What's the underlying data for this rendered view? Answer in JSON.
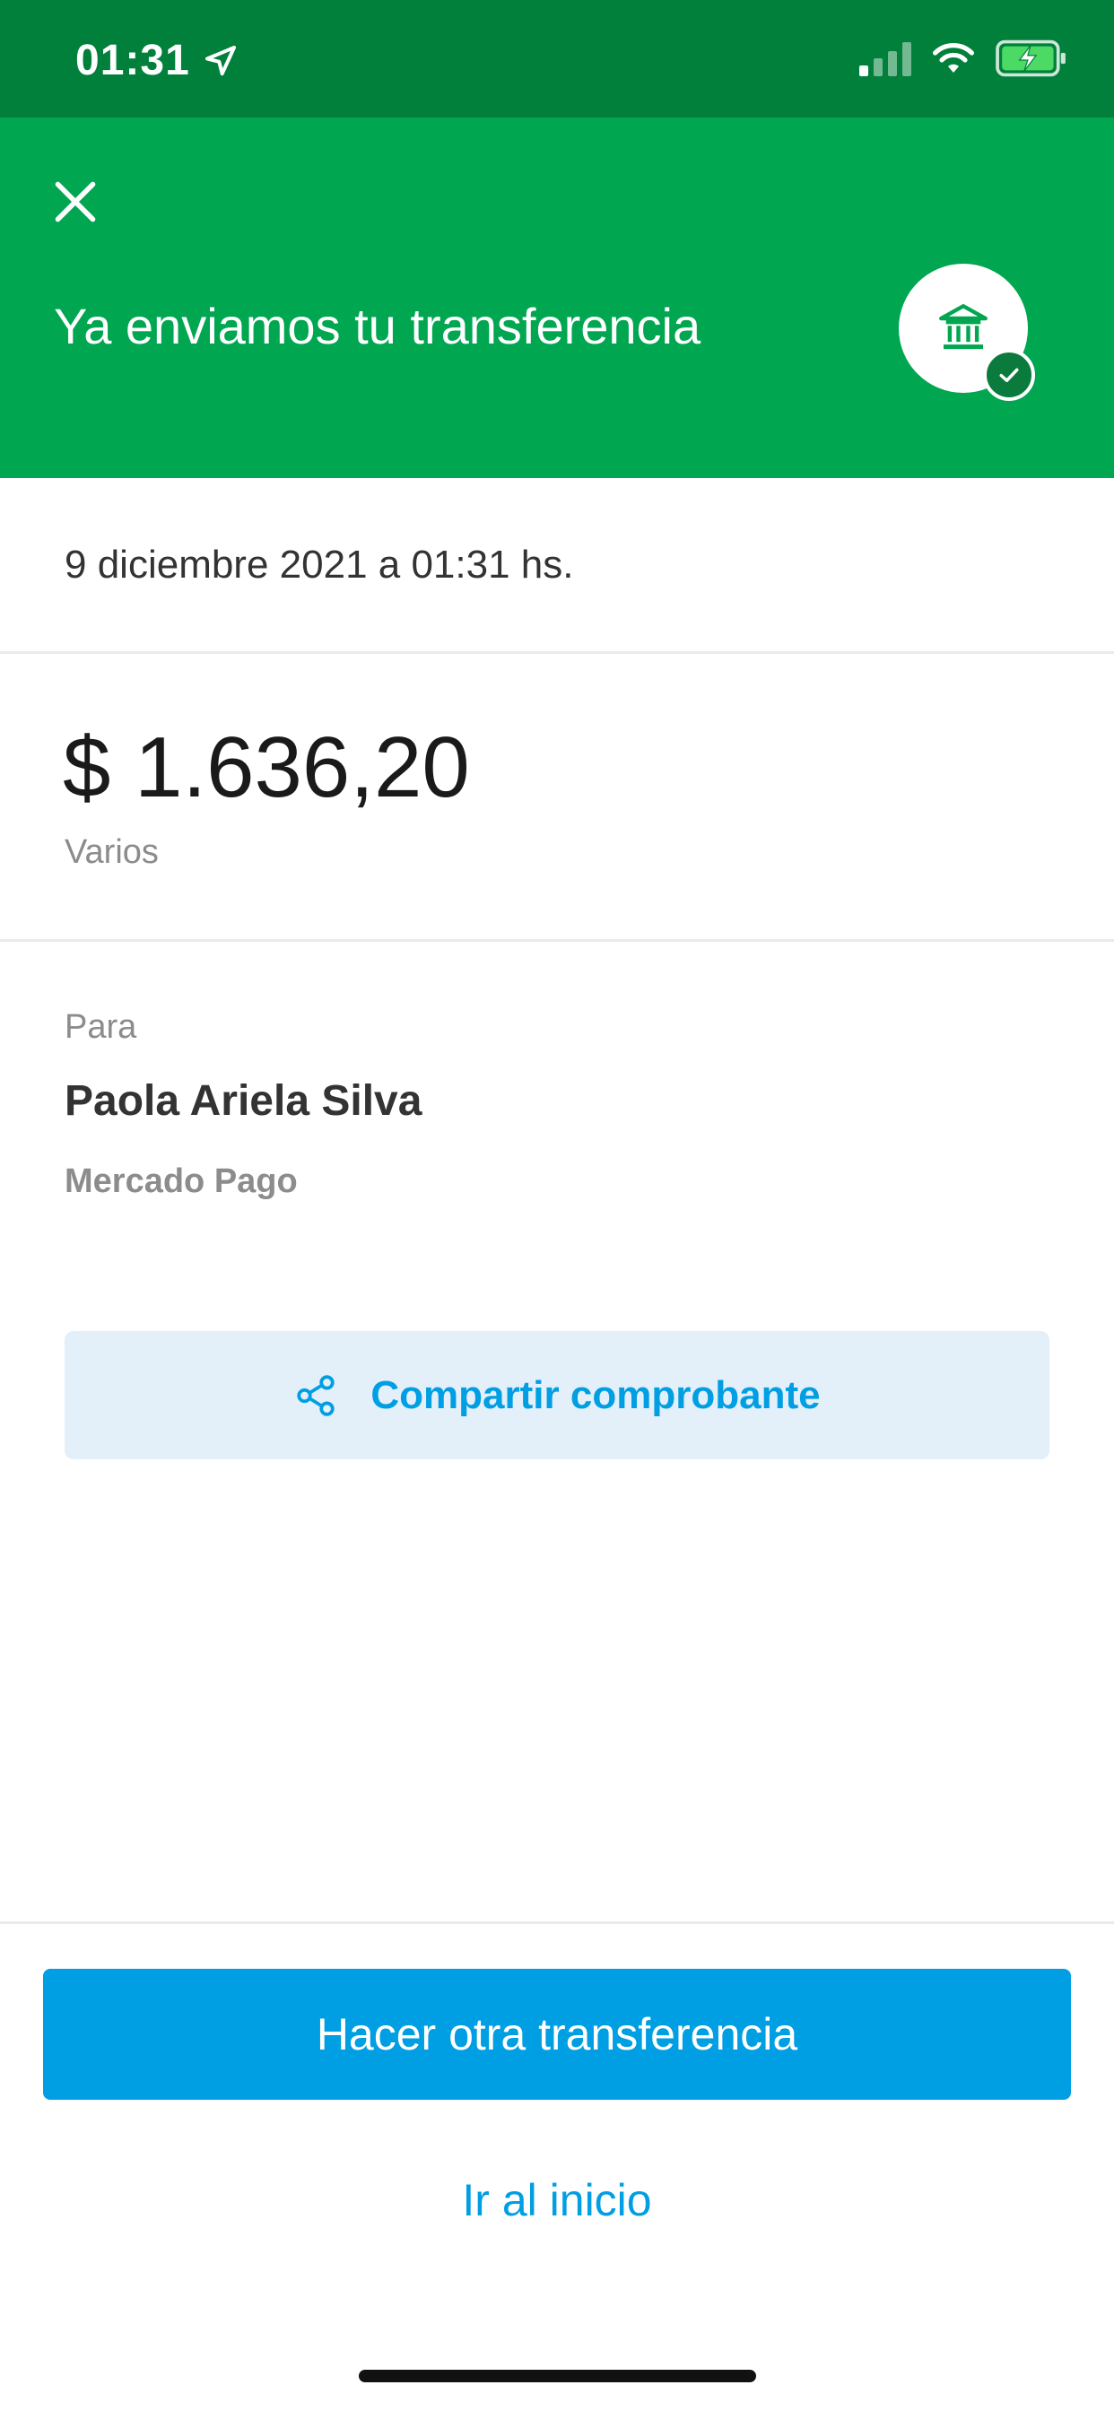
{
  "status_bar": {
    "time": "01:31"
  },
  "header": {
    "title": "Ya enviamos tu transferencia"
  },
  "transfer": {
    "datetime": "9 diciembre 2021 a 01:31 hs.",
    "amount": "$ 1.636,20",
    "concept": "Varios"
  },
  "recipient": {
    "label": "Para",
    "name": "Paola Ariela Silva",
    "bank": "Mercado Pago"
  },
  "actions": {
    "share_label": "Compartir comprobante",
    "primary_label": "Hacer otra transferencia",
    "home_label": "Ir al inicio"
  },
  "colors": {
    "status_bar": "#00803a",
    "header": "#00a650",
    "accent": "#009ee3",
    "share_bg": "#e3eff9"
  }
}
